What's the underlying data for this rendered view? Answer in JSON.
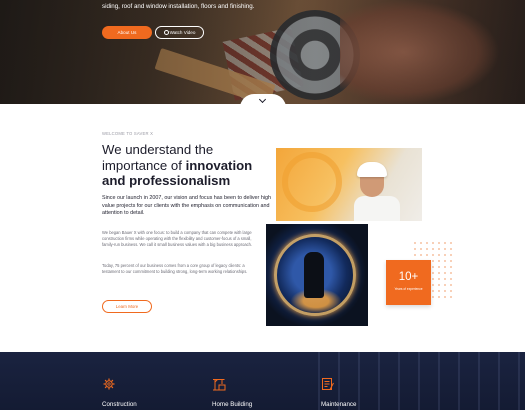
{
  "hero": {
    "subtitle": "siding, roof and window installation, floors and finishing.",
    "about_button": "About Us",
    "video_button": "Watch Video"
  },
  "about": {
    "eyebrow": "WELCOME TO SAVER X",
    "headline_plain": "We understand the importance of ",
    "headline_bold": "innovation and professionalism",
    "lead": "Since our launch in 2007, our vision and focus has been to deliver high value projects for our clients with the emphasis on communication and attention to detail.",
    "paragraph1": "We began Bauer X with one focus: to build a company that can compete with large construction firms while operating with the flexibility and customer-focus of a small, family-run business. We call it small business values with a big business approach.",
    "paragraph2": "Today, 75 percent of our business comes from a core group of legacy clients: a testament to our commitment to building strong, long-term working relationships.",
    "learn_button": "Learn More"
  },
  "badge": {
    "number": "10+",
    "label": "Years of experience"
  },
  "services": [
    {
      "title": "Construction",
      "icon": "gear-icon"
    },
    {
      "title": "Home Building",
      "icon": "crane-icon"
    },
    {
      "title": "Maintenance",
      "icon": "document-icon"
    }
  ],
  "colors": {
    "accent": "#f06a1f",
    "dark": "#1a2340",
    "text": "#1d1d2b"
  }
}
